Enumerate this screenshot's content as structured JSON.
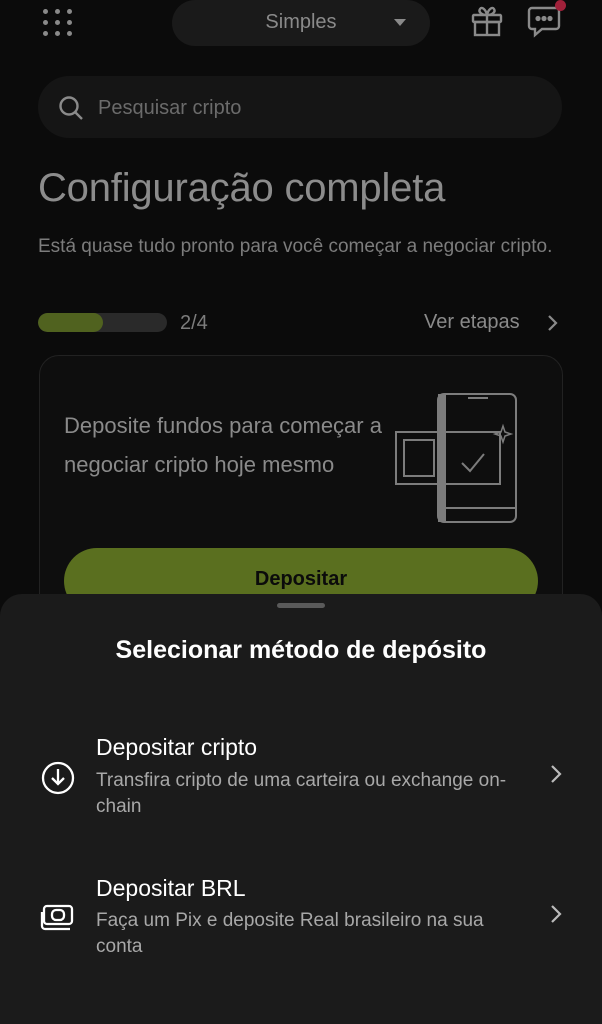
{
  "header": {
    "menu_icon": "grid-icon",
    "mode_selector": {
      "value": "Simples"
    },
    "gift_icon": "gift-icon",
    "chat_icon": "chat-icon",
    "notification_color": "#a0213a"
  },
  "search": {
    "placeholder": "Pesquisar cripto"
  },
  "setup": {
    "title": "Configuração completa",
    "subtitle": "Está quase tudo pronto para você começar a negociar cripto.",
    "progress": {
      "current": 2,
      "total": 4,
      "label": "2/4"
    },
    "steps_link": "Ver etapas"
  },
  "card": {
    "text": "Deposite fundos para começar a negociar cripto hoje mesmo",
    "button_label": "Depositar"
  },
  "sheet": {
    "title": "Selecionar método de depósito",
    "options": [
      {
        "icon": "download-icon",
        "title": "Depositar cripto",
        "description": "Transfira cripto de uma carteira ou exchange on-chain"
      },
      {
        "icon": "banknote-icon",
        "title": "Depositar BRL",
        "description": "Faça um Pix e deposite Real brasileiro na sua conta"
      }
    ]
  },
  "colors": {
    "accent": "#5a6f1f",
    "sheet_bg": "#1b1b1b",
    "background": "#0b0b0b"
  }
}
